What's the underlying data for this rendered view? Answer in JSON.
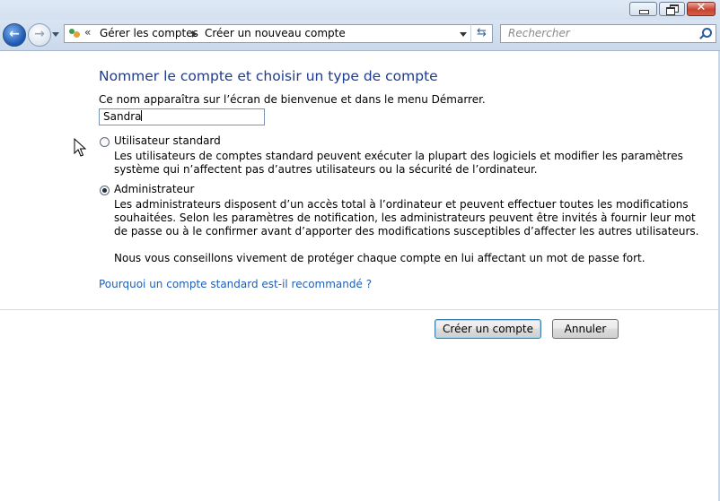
{
  "window": {
    "controls": {
      "minimize": "minimize",
      "maximize": "restore",
      "close": "close"
    }
  },
  "navbar": {
    "breadcrumb_chevron": "«",
    "breadcrumbs": [
      "Gérer les comptes",
      "Créer un nouveau compte"
    ],
    "search_placeholder": "Rechercher",
    "icons": [
      "back-arrow-icon",
      "forward-arrow-icon",
      "user-accounts-icon",
      "refresh-icon",
      "search-icon"
    ]
  },
  "content": {
    "heading": "Nommer le compte et choisir un type de compte",
    "hint": "Ce nom apparaîtra sur l’écran de bienvenue et dans le menu Démarrer.",
    "account_name": "Sandra",
    "options": [
      {
        "label": "Utilisateur standard",
        "selected": false,
        "description": [
          "Les utilisateurs de comptes standard peuvent exécuter la plupart des logiciels et modifier les paramètres",
          "système qui n’affectent pas d’autres utilisateurs ou la sécurité de l’ordinateur."
        ]
      },
      {
        "label": "Administrateur",
        "selected": true,
        "description": [
          "Les administrateurs disposent d’un accès total à l’ordinateur et peuvent effectuer toutes les modifications",
          "souhaitées. Selon les paramètres de notification, les administrateurs peuvent être invités à fournir leur mot",
          "de passe ou à le confirmer avant d’apporter des modifications susceptibles d’affecter les autres utilisateurs."
        ]
      }
    ],
    "advice": "Nous vous conseillons vivement de protéger chaque compte en lui affectant un mot de passe fort.",
    "why_link": "Pourquoi un compte standard est-il recommandé ?"
  },
  "buttons": {
    "create": "Créer un compte",
    "cancel": "Annuler"
  },
  "colors": {
    "heading": "#1e3b8c",
    "link": "#1f5fb4",
    "navbar": "#cad9eb"
  }
}
